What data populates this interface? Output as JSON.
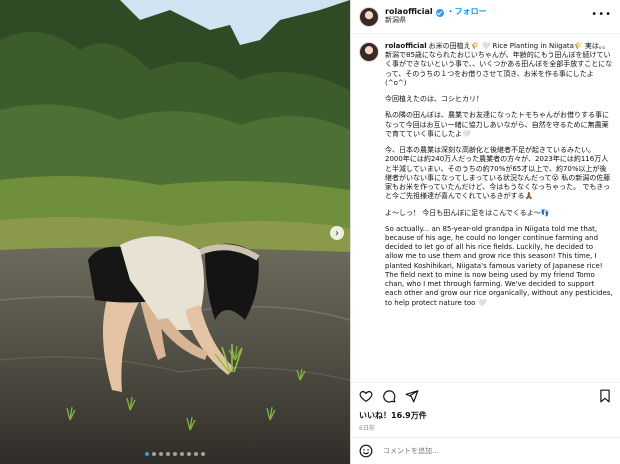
{
  "post": {
    "username": "rolaofficial",
    "follow_label": "・フォロー",
    "location": "新潟県",
    "more_icon": "more-horizontal-icon"
  },
  "caption": {
    "username": "rolaofficial",
    "paragraphs": [
      "お米の田植え🌾 🤍 Rice Planting in Niigata🌾 実は。。新潟で85歳になられたおじいちゃんが、年齢的にもう田んぼを続けていく事ができないという事で、、いくつかある田んぼを全部手放すことになって、そのうちの１つをお借りさせて頂き、お米を作る事にしたよ(^o^)",
      "今回植えたのは、コシヒカリ！",
      "私の隣の田んぼは、農業でお友達になったトモちゃんがお借りする事になって今回はお互い一緒に協力しあいながら、自然を守るために無農薬で育てていく事にしたよ🤍",
      "今、日本の農業は深刻な高齢化と後継者不足が起きているみたい。 2000年には約240万人だった農業者の方々が、2023年には約116万人と半減していまい、そのうちの約70%が65才以上で、約70%以上が後継者がいない事になってしまっている状況なんだって😮 私の新潟の佐藤家もお米を作っていたんだけど、今はもうなくなっちゃった。 でもきっと今ご先祖様達が喜んでくれているきがする🙏🏾",
      "よ〜しっ！ 今日も田んぼに足をはこんでくるよ〜👣",
      "So actually... an 85-year-old grandpa in Niigata told me that, because of his age, he could no longer continue farming and decided to let go of all his rice fields. Luckily, he decided to allow me to use them and grow rice this season! This time, I planted Koshihikari, Niigata's famous variety of Japanese rice! The field next to mine is now being used by my friend Tomo chan, who I met through farming. We've decided to support each other and grow our rice organically, without any pesticides, to help protect nature too 🤍"
    ]
  },
  "actions": {
    "like_icon": "heart-icon",
    "comment_icon": "comment-icon",
    "share_icon": "share-icon",
    "save_icon": "bookmark-icon"
  },
  "likes_text": "いいね！16.9万件",
  "time_ago": "6日前",
  "comment_placeholder": "コメントを追加...",
  "carousel": {
    "total": 9,
    "active": 0
  },
  "colors": {
    "accent": "#0095f6",
    "dot_active": "#3897f0"
  }
}
